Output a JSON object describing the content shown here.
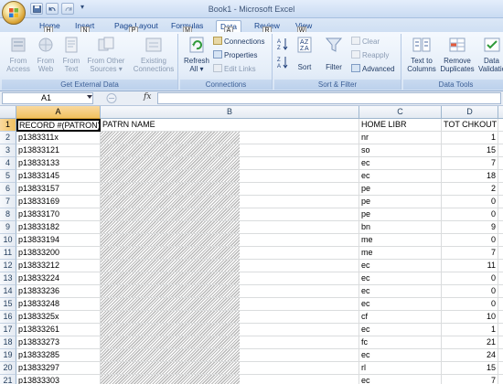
{
  "window": {
    "title": "Book1 - Microsoft Excel"
  },
  "tabs": [
    {
      "label": "Home",
      "keytip": "H",
      "active": false
    },
    {
      "label": "Insert",
      "keytip": "N",
      "active": false
    },
    {
      "label": "Page Layout",
      "keytip": "P",
      "active": false
    },
    {
      "label": "Formulas",
      "keytip": "M",
      "active": false
    },
    {
      "label": "Data",
      "keytip": "A",
      "active": true
    },
    {
      "label": "Review",
      "keytip": "R",
      "active": false
    },
    {
      "label": "View",
      "keytip": "W",
      "active": false
    }
  ],
  "ribbon": {
    "get_external_data": {
      "label": "Get External Data",
      "buttons": [
        {
          "line1": "From",
          "line2": "Access",
          "icon": "access-icon"
        },
        {
          "line1": "From",
          "line2": "Web",
          "icon": "web-icon"
        },
        {
          "line1": "From",
          "line2": "Text",
          "icon": "text-file-icon"
        },
        {
          "line1": "From Other",
          "line2": "Sources ▾",
          "icon": "other-sources-icon"
        },
        {
          "line1": "Existing",
          "line2": "Connections",
          "icon": "existing-connections-icon"
        }
      ]
    },
    "connections": {
      "label": "Connections",
      "refresh": {
        "line1": "Refresh",
        "line2": "All ▾"
      },
      "items": [
        "Connections",
        "Properties",
        "Edit Links"
      ]
    },
    "sort_filter": {
      "label": "Sort & Filter",
      "sort": "Sort",
      "filter": "Filter",
      "items": [
        "Clear",
        "Reapply",
        "Advanced"
      ]
    },
    "data_tools": {
      "label": "Data Tools",
      "text_to_columns": {
        "line1": "Text to",
        "line2": "Columns"
      },
      "remove_duplicates": {
        "line1": "Remove",
        "line2": "Duplicates"
      },
      "data_validation": {
        "line1": "Data",
        "line2": "Validation"
      }
    }
  },
  "formula_bar": {
    "name_box": "A1",
    "fx": "fx",
    "formula": ""
  },
  "columns": [
    {
      "letter": "A",
      "selected": true
    },
    {
      "letter": "B",
      "selected": false
    },
    {
      "letter": "C",
      "selected": false
    },
    {
      "letter": "D",
      "selected": false
    }
  ],
  "rows": [
    {
      "n": "1",
      "a": "RECORD #(PATRON)",
      "b": "PATRN NAME",
      "c": "HOME LIBR",
      "d": "TOT CHKOUT"
    },
    {
      "n": "2",
      "a": "p1383311x",
      "b": "",
      "c": "nr",
      "d": "1"
    },
    {
      "n": "3",
      "a": "p13833121",
      "b": "",
      "c": "so",
      "d": "15"
    },
    {
      "n": "4",
      "a": "p13833133",
      "b": "",
      "c": "ec",
      "d": "7"
    },
    {
      "n": "5",
      "a": "p13833145",
      "b": "",
      "c": "ec",
      "d": "18"
    },
    {
      "n": "6",
      "a": "p13833157",
      "b": "",
      "c": "pe",
      "d": "2"
    },
    {
      "n": "7",
      "a": "p13833169",
      "b": "",
      "c": "pe",
      "d": "0"
    },
    {
      "n": "8",
      "a": "p13833170",
      "b": "",
      "c": "pe",
      "d": "0"
    },
    {
      "n": "9",
      "a": "p13833182",
      "b": "",
      "c": "bn",
      "d": "9"
    },
    {
      "n": "10",
      "a": "p13833194",
      "b": "",
      "c": "me",
      "d": "0"
    },
    {
      "n": "11",
      "a": "p13833200",
      "b": "",
      "c": "me",
      "d": "7"
    },
    {
      "n": "12",
      "a": "p13833212",
      "b": "",
      "c": "ec",
      "d": "11"
    },
    {
      "n": "13",
      "a": "p13833224",
      "b": "",
      "c": "ec",
      "d": "0"
    },
    {
      "n": "14",
      "a": "p13833236",
      "b": "",
      "c": "ec",
      "d": "0"
    },
    {
      "n": "15",
      "a": "p13833248",
      "b": "",
      "c": "ec",
      "d": "0"
    },
    {
      "n": "16",
      "a": "p1383325x",
      "b": "",
      "c": "cf",
      "d": "10"
    },
    {
      "n": "17",
      "a": "p13833261",
      "b": "",
      "c": "ec",
      "d": "1"
    },
    {
      "n": "18",
      "a": "p13833273",
      "b": "",
      "c": "fc",
      "d": "21"
    },
    {
      "n": "19",
      "a": "p13833285",
      "b": "",
      "c": "ec",
      "d": "24"
    },
    {
      "n": "20",
      "a": "p13833297",
      "b": "",
      "c": "rl",
      "d": "15"
    },
    {
      "n": "21",
      "a": "p13833303",
      "b": "",
      "c": "ec",
      "d": "7"
    }
  ]
}
